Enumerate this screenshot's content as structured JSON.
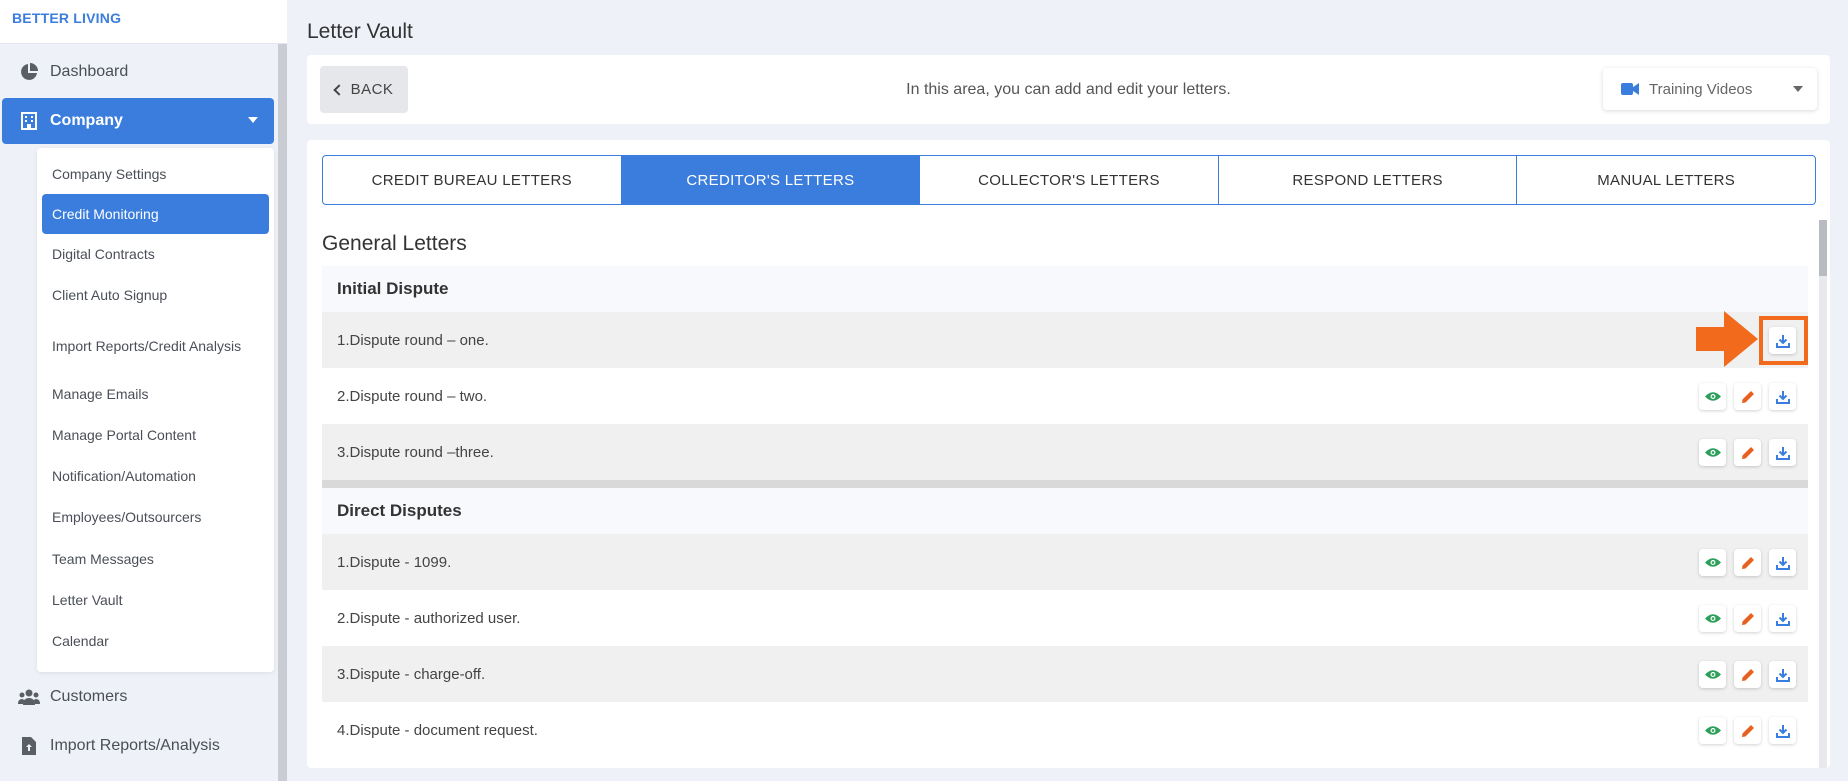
{
  "brand": "BETTER LIVING",
  "sidebar": {
    "dashboard": "Dashboard",
    "company": "Company",
    "customers": "Customers",
    "import_reports": "Import Reports/Analysis",
    "submenu": [
      "Company Settings",
      "Credit Monitoring",
      "Digital Contracts",
      "Client Auto Signup",
      "Import Reports/Credit Analysis",
      "Manage Emails",
      "Manage Portal Content",
      "Notification/Automation",
      "Employees/Outsourcers",
      "Team Messages",
      "Letter Vault",
      "Calendar"
    ]
  },
  "page": {
    "title": "Letter Vault",
    "back_label": "BACK",
    "info": "In this area, you can add and edit your letters.",
    "training_label": "Training Videos"
  },
  "tabs": [
    "CREDIT BUREAU LETTERS",
    "CREDITOR'S LETTERS",
    "COLLECTOR'S LETTERS",
    "RESPOND LETTERS",
    "MANUAL LETTERS"
  ],
  "active_tab": "CREDITOR'S LETTERS",
  "section_title": "General Letters",
  "groups": [
    {
      "title": "Initial Dispute",
      "rows": [
        "1.Dispute round – one.",
        "2.Dispute round – two.",
        "3.Dispute round –three."
      ]
    },
    {
      "title": "Direct Disputes",
      "rows": [
        "1.Dispute - 1099.",
        "2.Dispute - authorized user.",
        "3.Dispute - charge-off.",
        "4.Dispute - document request."
      ]
    }
  ],
  "colors": {
    "accent": "#3b7ddd",
    "view_icon": "#2e9e5b",
    "edit_icon": "#e8601c",
    "highlight": "#f26b1d"
  },
  "icons": {
    "view": "eye-icon",
    "edit": "pencil-icon",
    "download": "download-icon"
  }
}
